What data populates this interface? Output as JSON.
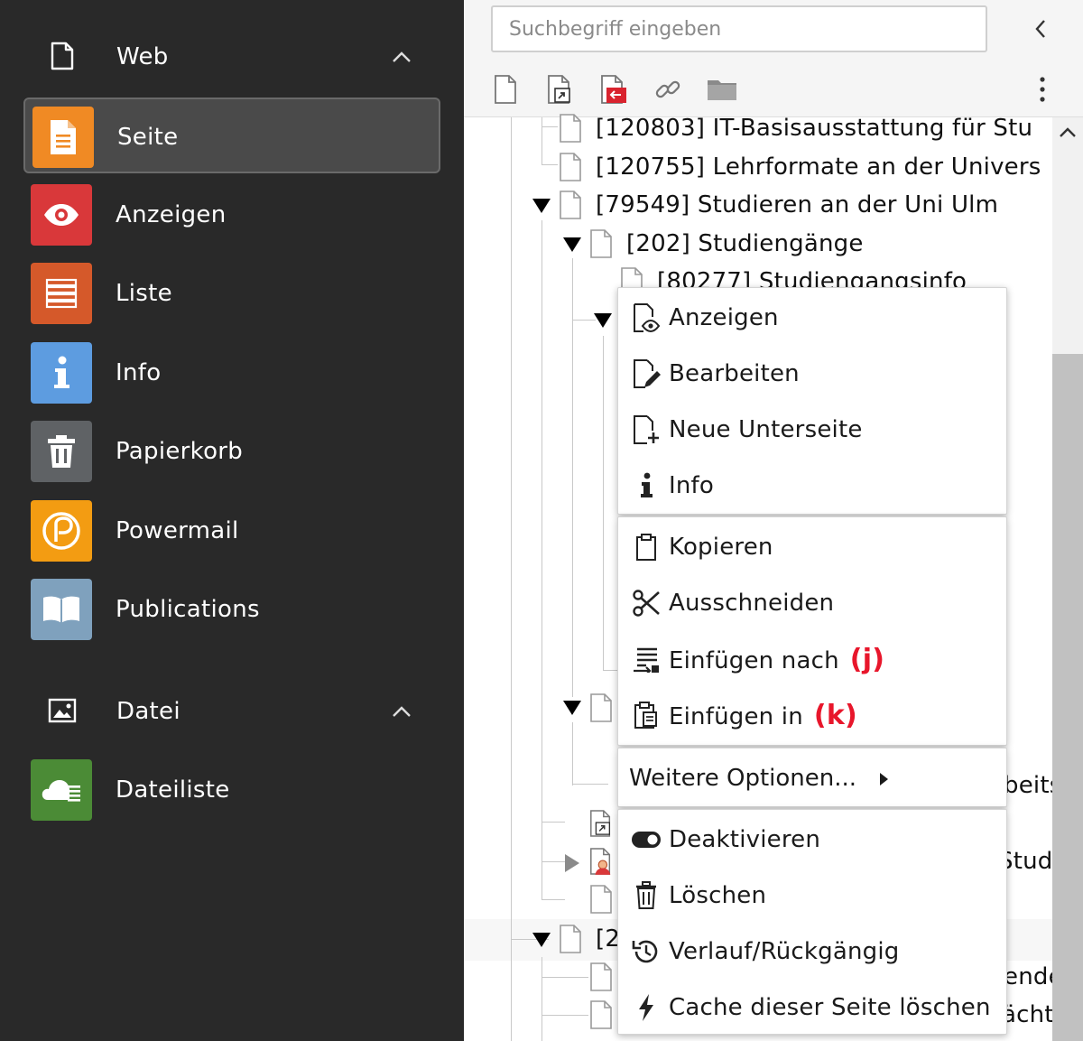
{
  "modmenu": {
    "web": {
      "label": "Web",
      "icon": "page-outline-icon"
    },
    "items_web": [
      {
        "label": "Seite",
        "icon": "page-icon",
        "color": "#f08a24",
        "active": true
      },
      {
        "label": "Anzeigen",
        "icon": "eye-icon",
        "color": "#d9383a"
      },
      {
        "label": "Liste",
        "icon": "list-icon",
        "color": "#d5592a"
      },
      {
        "label": "Info",
        "icon": "info-icon",
        "color": "#5d9ce0"
      },
      {
        "label": "Papierkorb",
        "icon": "trash-icon",
        "color": "#5f6265"
      },
      {
        "label": "Powermail",
        "icon": "powermail-icon",
        "color": "#f39c12"
      },
      {
        "label": "Publications",
        "icon": "book-icon",
        "color": "#7fa1bd"
      }
    ],
    "datei": {
      "label": "Datei",
      "icon": "image-icon"
    },
    "items_datei": [
      {
        "label": "Dateiliste",
        "icon": "cloud-files-icon",
        "color": "#4b8b36"
      }
    ]
  },
  "tree": {
    "search_placeholder": "Suchbegriff eingeben",
    "nodes": [
      {
        "label": "[120803] IT-Basisausstattung für Stu"
      },
      {
        "label": "[120755] Lehrformate an der Univers"
      },
      {
        "label": "[79549] Studieren an der Uni Ulm"
      },
      {
        "label": "[202] Studiengänge"
      },
      {
        "label": "[80277] Studiengangsinfo"
      },
      {
        "label": "beits"
      },
      {
        "label": "Stud"
      },
      {
        "label": "[2"
      },
      {
        "label": "ende"
      },
      {
        "label": "ächt"
      }
    ]
  },
  "context_menu": {
    "group1": [
      {
        "label": "Anzeigen",
        "icon": "page-view-icon"
      },
      {
        "label": "Bearbeiten",
        "icon": "page-edit-icon"
      },
      {
        "label": "Neue Unterseite",
        "icon": "page-new-icon"
      },
      {
        "label": "Info",
        "icon": "info-icon"
      }
    ],
    "group2": [
      {
        "label": "Kopieren",
        "icon": "clipboard-icon"
      },
      {
        "label": "Ausschneiden",
        "icon": "scissors-icon"
      },
      {
        "label": "Einfügen nach",
        "icon": "paste-after-icon",
        "hint": "(j)"
      },
      {
        "label": "Einfügen in",
        "icon": "paste-into-icon",
        "hint": "(k)"
      }
    ],
    "more": {
      "label": "Weitere Optionen..."
    },
    "group3": [
      {
        "label": "Deaktivieren",
        "icon": "toggle-off-icon"
      },
      {
        "label": "Löschen",
        "icon": "trash-icon"
      },
      {
        "label": "Verlauf/Rückgängig",
        "icon": "history-icon"
      },
      {
        "label": "Cache dieser Seite löschen",
        "icon": "lightning-icon"
      }
    ]
  }
}
